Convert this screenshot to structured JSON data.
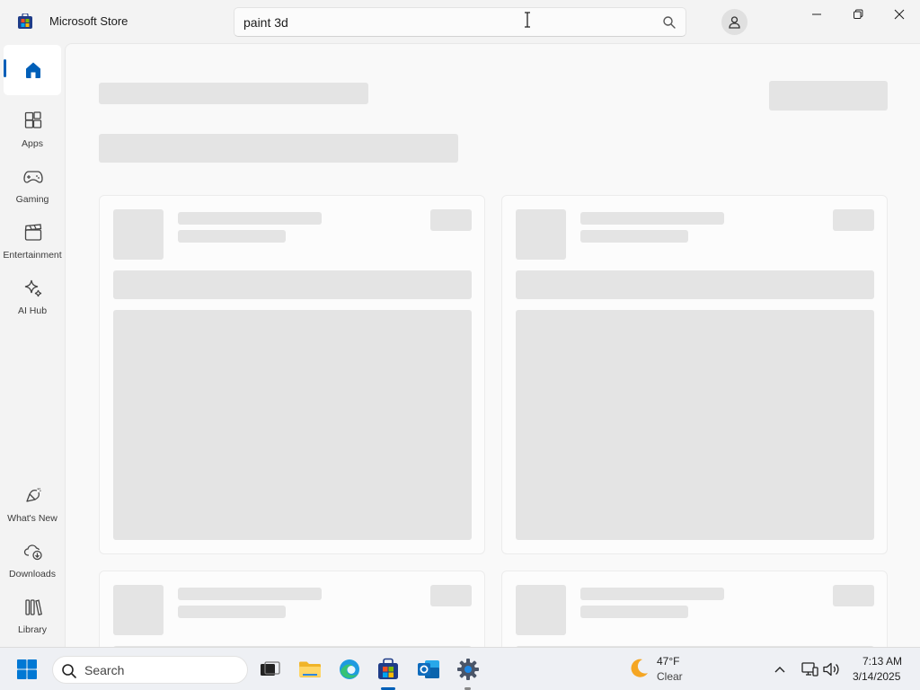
{
  "app": {
    "title": "Microsoft Store"
  },
  "search": {
    "value": "paint 3d",
    "icon": "search-icon"
  },
  "sidebar": {
    "items": [
      {
        "label": "",
        "icon": "home-icon",
        "active": true
      },
      {
        "label": "Apps",
        "icon": "apps-icon"
      },
      {
        "label": "Gaming",
        "icon": "gamepad-icon"
      },
      {
        "label": "Entertainment",
        "icon": "clapperboard-icon"
      },
      {
        "label": "AI Hub",
        "icon": "sparkle-icon"
      },
      {
        "label": "What's New",
        "icon": "megaphone-icon"
      },
      {
        "label": "Downloads",
        "icon": "cloud-download-icon"
      },
      {
        "label": "Library",
        "icon": "library-icon"
      }
    ]
  },
  "taskbar": {
    "search_label": "Search",
    "weather": {
      "temp": "47°F",
      "condition": "Clear"
    },
    "clock": {
      "time": "7:13 AM",
      "date": "3/14/2025"
    }
  },
  "colors": {
    "accent": "#005fb8",
    "skeleton": "#e4e4e4",
    "background": "#f3f3f3"
  }
}
